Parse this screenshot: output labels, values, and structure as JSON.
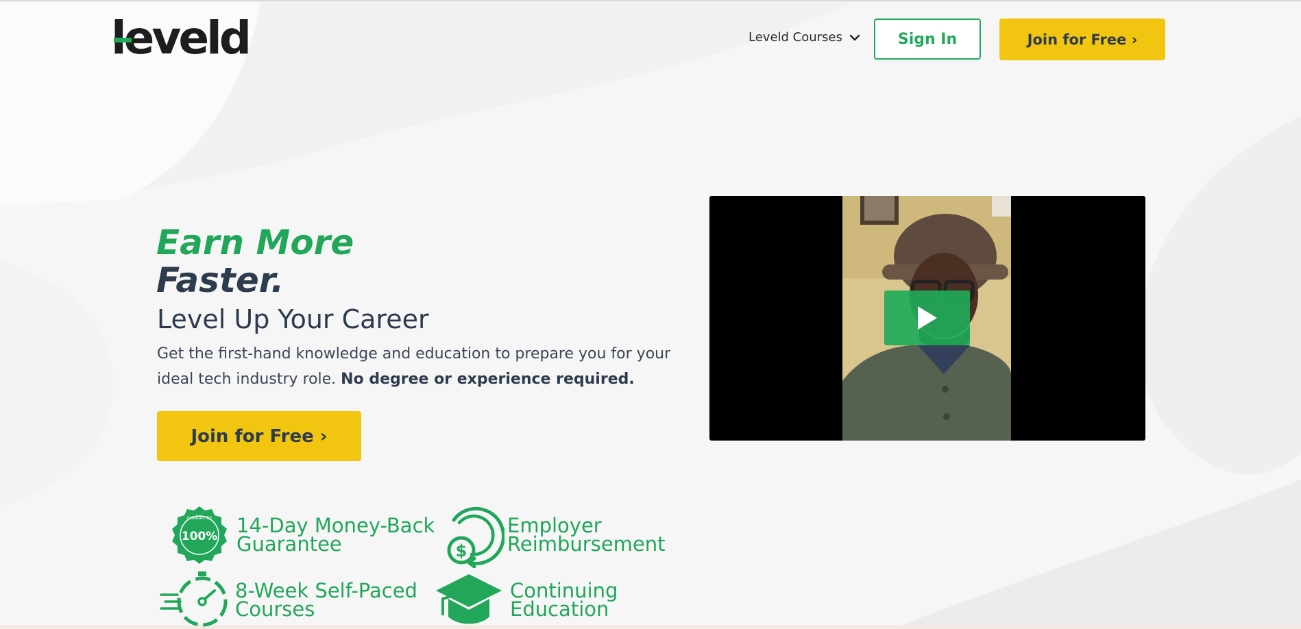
{
  "colors": {
    "brand_green": "#21a65a",
    "brand_yellow": "#f2c511",
    "navy": "#2d3b4e"
  },
  "header": {
    "logo_text": "leveld",
    "nav_courses": "Leveld Courses",
    "sign_in": "Sign In",
    "join_free": "Join for Free ›"
  },
  "hero": {
    "line1": "Earn More",
    "line2": "Faster.",
    "subtitle": "Level Up Your Career",
    "description_lead": "Get the first-hand knowledge and education to prepare you for your ideal tech industry role. ",
    "description_bold": "No degree or experience required.",
    "cta": "Join for Free ›"
  },
  "video": {
    "play_icon": "play-icon"
  },
  "features": [
    {
      "icon": "guarantee-seal-icon",
      "line1": "14-Day Money-Back",
      "line2": "Guarantee",
      "seal_text": "100%",
      "seal_ring_text": "GUARANTEE"
    },
    {
      "icon": "dollar-refund-icon",
      "line1": "Employer",
      "line2": "Reimbursement"
    },
    {
      "icon": "stopwatch-icon",
      "line1": "8-Week Self-Paced",
      "line2": "Courses"
    },
    {
      "icon": "graduation-cap-icon",
      "line1": "Continuing",
      "line2": "Education"
    }
  ]
}
